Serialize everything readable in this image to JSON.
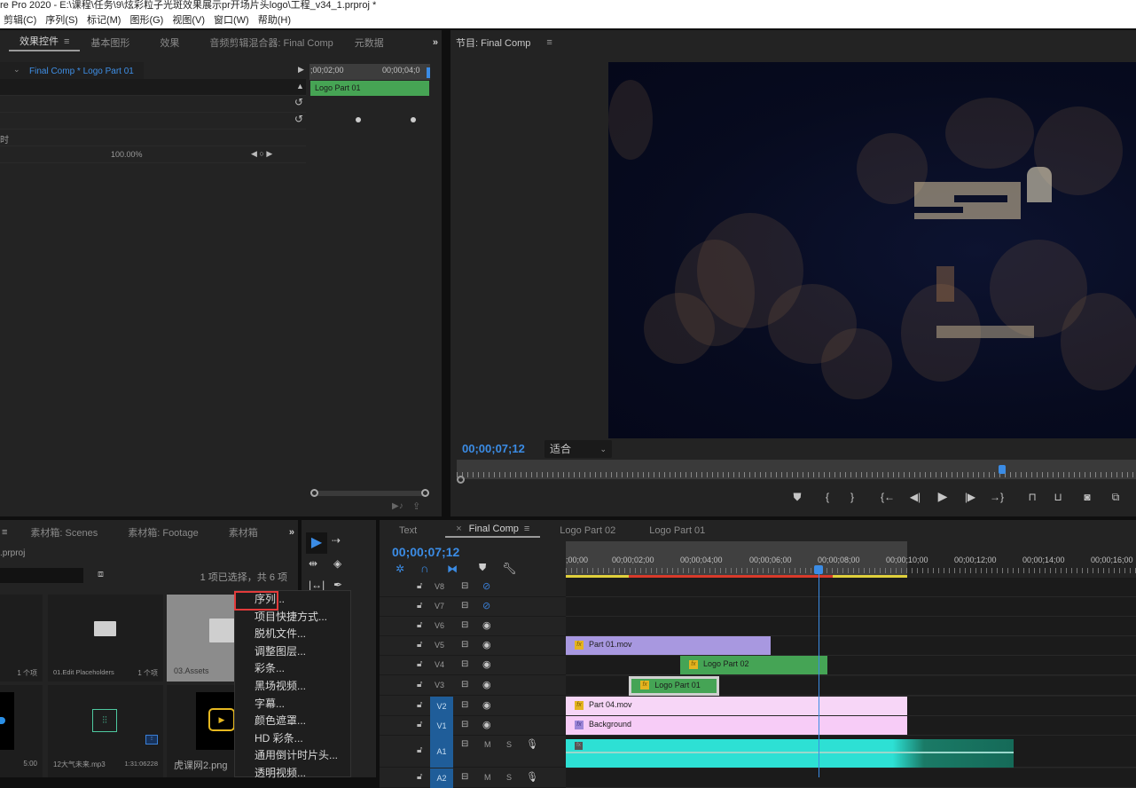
{
  "titlebar": {
    "title": "re Pro 2020 - E:\\课程\\任务\\9\\炫彩粒子光斑效果展示pr开场片头logo\\工程_v34_1.prproj *"
  },
  "menubar": {
    "items": [
      "剪辑(C)",
      "序列(S)",
      "标记(M)",
      "图形(G)",
      "视图(V)",
      "窗口(W)",
      "帮助(H)"
    ]
  },
  "effects_panel": {
    "tabs": [
      "效果控件",
      "基本图形",
      "效果",
      "音频剪辑混合器: Final Comp",
      "元数据"
    ],
    "active_tab": "效果控件",
    "overflow": "»",
    "clip_selector": "Final Comp * Logo Part 01",
    "mini_ruler": [
      ";00;02;00",
      "00;00;04;0"
    ],
    "mini_clip": "Logo Part 01",
    "row_label_partial": "时",
    "value": "100.00%"
  },
  "program_monitor": {
    "title": "节目: Final Comp",
    "timecode": "00;00;07;12",
    "fit": "适合",
    "playhead_fraction": 0.8,
    "transport": [
      "marker",
      "mark-in",
      "mark-out",
      "go-to-in",
      "step-back",
      "play",
      "step-forward",
      "go-to-out",
      "lift",
      "extract",
      "export-frame",
      "compare"
    ]
  },
  "project_panel": {
    "tabs": [
      "素材箱: Scenes",
      "素材箱: Footage",
      "素材箱"
    ],
    "overflow": "»",
    "path": ".prproj",
    "status": "1 项已选择，共 6 项",
    "items": [
      {
        "name": "",
        "meta": "1 个项",
        "type": "folder-partial"
      },
      {
        "name": "01.Edit Placeholders",
        "meta": "1 个项",
        "type": "folder"
      },
      {
        "name": "03.Assets",
        "meta": "",
        "type": "folder",
        "selected": true
      },
      {
        "name": "",
        "meta": "5:00",
        "type": "video-partial"
      },
      {
        "name": "12大气未来.mp3",
        "meta": "1:31:06228",
        "type": "audio"
      },
      {
        "name": "虎课网2.png",
        "meta": "",
        "type": "image"
      }
    ]
  },
  "context_menu": {
    "items": [
      "序列...",
      "项目快捷方式...",
      "脱机文件...",
      "调整图层...",
      "彩条...",
      "黑场视频...",
      "字幕...",
      "颜色遮罩...",
      "HD 彩条...",
      "通用倒计时片头...",
      "透明视频..."
    ],
    "highlighted": "序列..."
  },
  "timeline": {
    "tabs": [
      "Text",
      "Final Comp",
      "Logo Part 02",
      "Logo Part 01"
    ],
    "active_tab": "Final Comp",
    "timecode": "00;00;07;12",
    "ruler": [
      ";00;00",
      "00;00;02;00",
      "00;00;04;00",
      "00;00;06;00",
      "00;00;08;00",
      "00;00;10;00",
      "00;00;12;00",
      "00;00;14;00",
      "00;00;16;00"
    ],
    "tracks": [
      {
        "name": "V8",
        "visible": false
      },
      {
        "name": "V7",
        "visible": false
      },
      {
        "name": "V6",
        "visible": true
      },
      {
        "name": "V5",
        "visible": true
      },
      {
        "name": "V4",
        "visible": true
      },
      {
        "name": "V3",
        "visible": true
      },
      {
        "name": "V2",
        "visible": true,
        "targeted": true
      },
      {
        "name": "V1",
        "visible": true,
        "targeted": true
      },
      {
        "name": "A1",
        "targeted": true,
        "m": "M",
        "s": "S"
      },
      {
        "name": "A2",
        "targeted": true,
        "m": "M",
        "s": "S"
      }
    ],
    "clips": [
      {
        "track": "V5",
        "label": "Part 01.mov",
        "color": "#a898e0"
      },
      {
        "track": "V4",
        "label": "Logo Part 02",
        "color": "#45a455"
      },
      {
        "track": "V3",
        "label": "Logo Part 01",
        "color": "#45a455"
      },
      {
        "track": "V2",
        "label": "Part 04.mov",
        "color": "#f7d6f7"
      },
      {
        "track": "V1",
        "label": "Background",
        "color": "#f7ccf7"
      }
    ]
  }
}
